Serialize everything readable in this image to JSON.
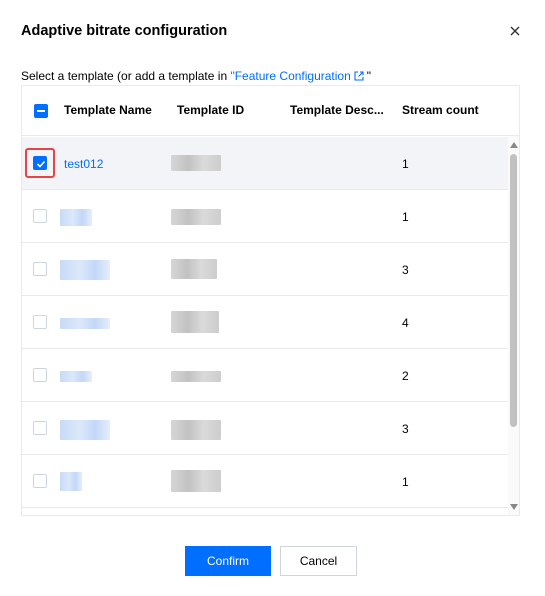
{
  "dialog": {
    "title": "Adaptive bitrate configuration",
    "subtitle_prefix": "Select a template (or add a template in ",
    "subtitle_link": "\"Feature Configuration",
    "subtitle_suffix": "\"",
    "close_icon": "close-icon"
  },
  "table": {
    "headers": [
      "Template Name",
      "Template ID",
      "Template Desc...",
      "Stream count"
    ],
    "rows": [
      {
        "name": "test012",
        "stream_count": "1",
        "selected": true
      },
      {
        "name": "",
        "stream_count": "1",
        "selected": false
      },
      {
        "name": "",
        "stream_count": "3",
        "selected": false
      },
      {
        "name": "",
        "stream_count": "4",
        "selected": false
      },
      {
        "name": "",
        "stream_count": "2",
        "selected": false
      },
      {
        "name": "",
        "stream_count": "3",
        "selected": false
      },
      {
        "name": "",
        "stream_count": "1",
        "selected": false
      }
    ]
  },
  "buttons": {
    "confirm": "Confirm",
    "cancel": "Cancel"
  },
  "colors": {
    "accent": "#006eff",
    "highlight": "#e54545",
    "selected_row": "#f3f4f7"
  }
}
